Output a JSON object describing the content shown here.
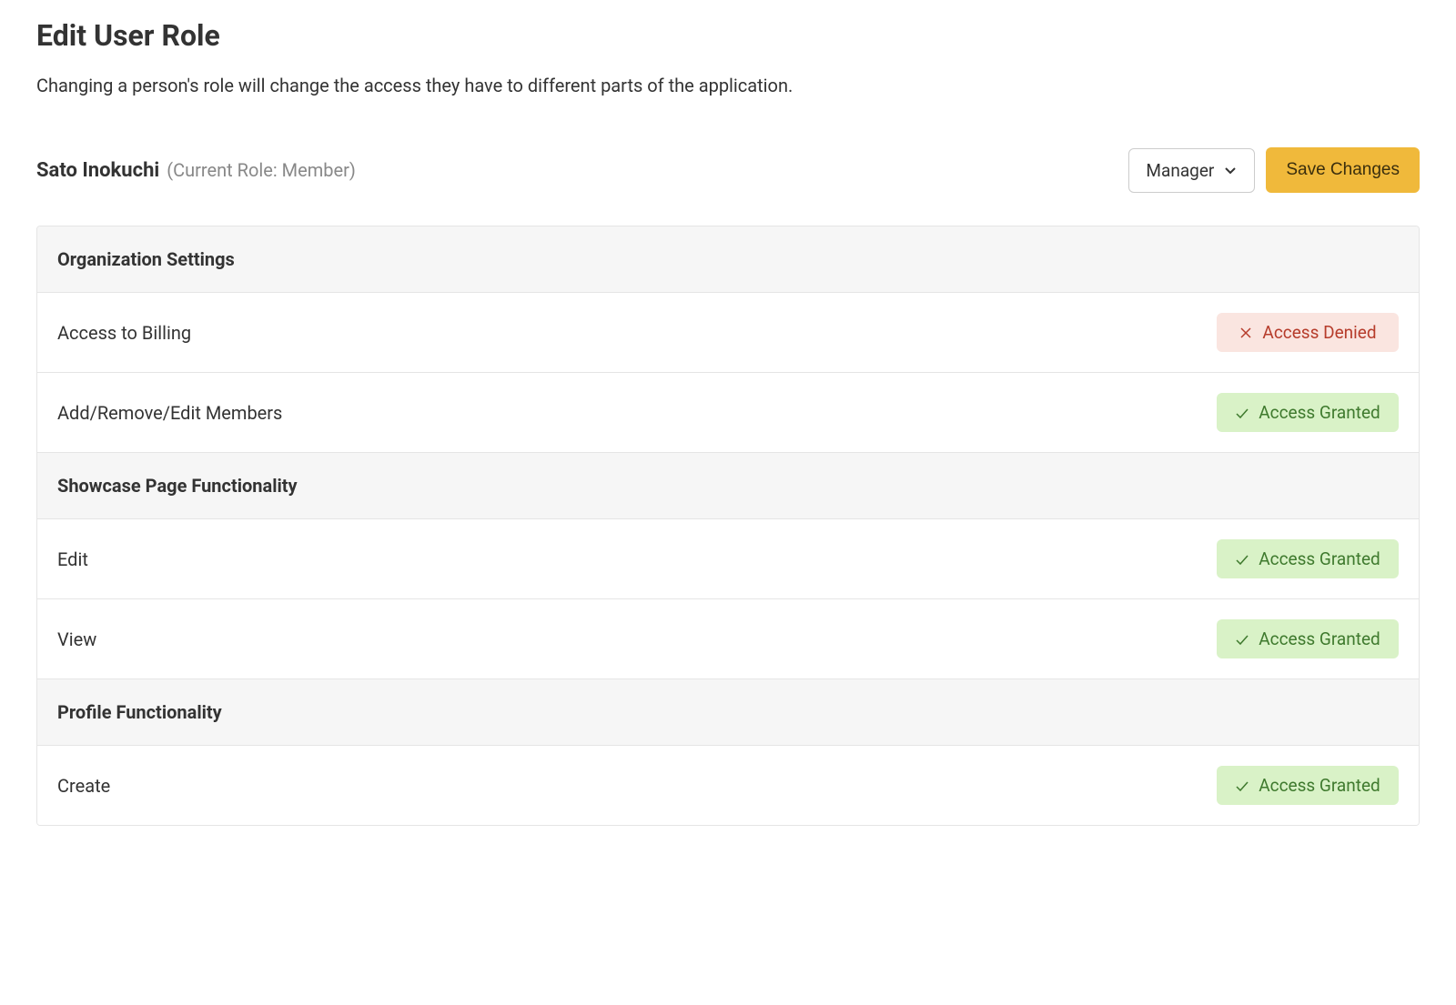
{
  "page": {
    "title": "Edit User Role",
    "description": "Changing a person's role will change the access they have to different parts of the application."
  },
  "user": {
    "name": "Sato Inokuchi",
    "current_role_label": "(Current Role: Member)"
  },
  "controls": {
    "role_dropdown_value": "Manager",
    "save_button_label": "Save Changes"
  },
  "badges": {
    "denied_label": "Access Denied",
    "granted_label": "Access Granted"
  },
  "sections": [
    {
      "title": "Organization Settings",
      "items": [
        {
          "label": "Access to Billing",
          "status": "denied"
        },
        {
          "label": "Add/Remove/Edit Members",
          "status": "granted"
        }
      ]
    },
    {
      "title": "Showcase Page Functionality",
      "items": [
        {
          "label": "Edit",
          "status": "granted"
        },
        {
          "label": "View",
          "status": "granted"
        }
      ]
    },
    {
      "title": "Profile Functionality",
      "items": [
        {
          "label": "Create",
          "status": "granted"
        }
      ]
    }
  ]
}
